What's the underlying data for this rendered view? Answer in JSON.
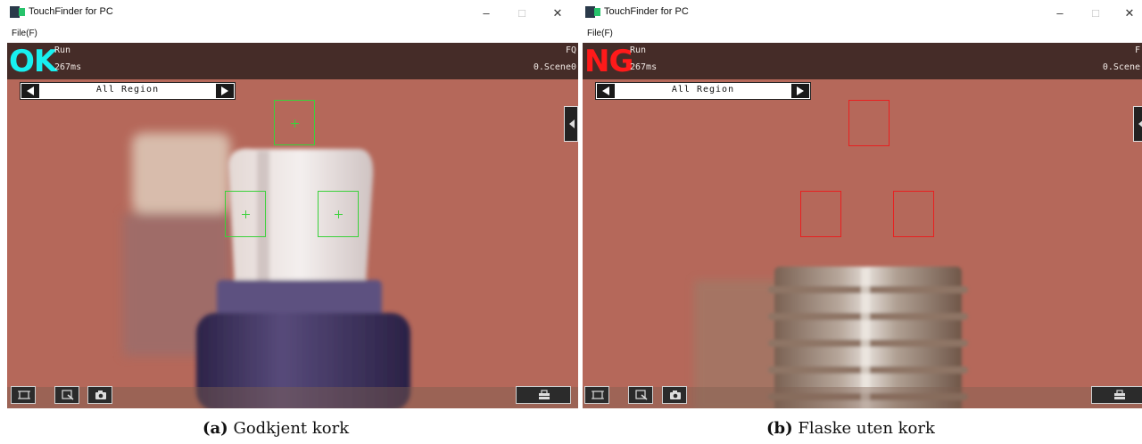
{
  "window_title": "TouchFinder for PC",
  "menu_file": "File(F)",
  "window_controls": {
    "minimize": "–",
    "maximize": "□",
    "close": "✕"
  },
  "panels": [
    {
      "judgement": "OK",
      "judgement_color": "#18f0f0",
      "mode": "Run",
      "time": "267ms",
      "model": "FQ",
      "scene": "0.Scene0",
      "region_label": "All Region",
      "roi_color": "#3bd13b",
      "caption_tag": "(a)",
      "caption_text": "Godkjent kork"
    },
    {
      "judgement": "NG",
      "judgement_color": "#ff1a1a",
      "mode": "Run",
      "time": "267ms",
      "model": "F",
      "scene": "0.Scene",
      "region_label": "All Region",
      "roi_color": "#e82020",
      "caption_tag": "(b)",
      "caption_text": "Flaske uten kork"
    }
  ],
  "icons": {
    "prev": "triangle-left-icon",
    "next": "triangle-right-icon",
    "side_tab": "caret-left-icon",
    "tool_1": "crop-frame-icon",
    "tool_2": "zoom-window-icon",
    "tool_3": "camera-icon",
    "tool_4": "toolbox-icon"
  },
  "colors": {
    "background_scene": "#b5685a",
    "header_bar": "#452c28"
  }
}
